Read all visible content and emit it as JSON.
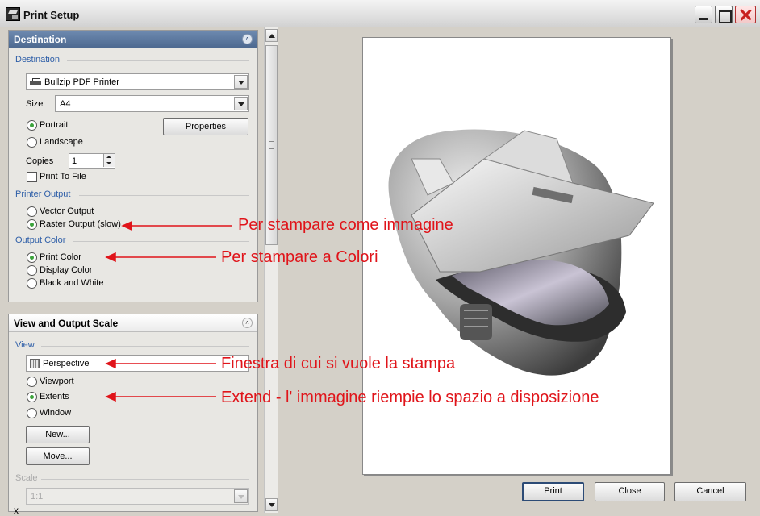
{
  "window": {
    "title": "Print Setup"
  },
  "destination_panel": {
    "header": "Destination",
    "group_label": "Destination",
    "printer": "Bullzip PDF Printer",
    "size_label": "Size",
    "size_value": "A4",
    "properties_button": "Properties",
    "portrait": "Portrait",
    "landscape": "Landscape",
    "copies_label": "Copies",
    "copies_value": "1",
    "print_to_file": "Print To File",
    "printer_output_label": "Printer Output",
    "vector_output": "Vector Output",
    "raster_output": "Raster Output (slow)",
    "output_color_label": "Output Color",
    "print_color": "Print Color",
    "display_color": "Display Color",
    "black_white": "Black and White"
  },
  "view_panel": {
    "header": "View and Output Scale",
    "view_label": "View",
    "view_value": "Perspective",
    "viewport": "Viewport",
    "extents": "Extents",
    "window": "Window",
    "new_button": "New...",
    "move_button": "Move...",
    "scale_label": "Scale",
    "scale_value": "1:1"
  },
  "buttons": {
    "print": "Print",
    "close": "Close",
    "cancel": "Cancel"
  },
  "status": {
    "x": "x"
  },
  "annotations": {
    "raster": "Per stampare come immagine",
    "color": "Per stampare a Colori",
    "view": "Finestra di cui si vuole la stampa",
    "extents": "Extend - l' immagine riempie lo spazio a disposizione"
  },
  "colors": {
    "annotation": "#e0141a",
    "accent_header": "#5a7398",
    "radio_selected": "#3ca33c"
  }
}
